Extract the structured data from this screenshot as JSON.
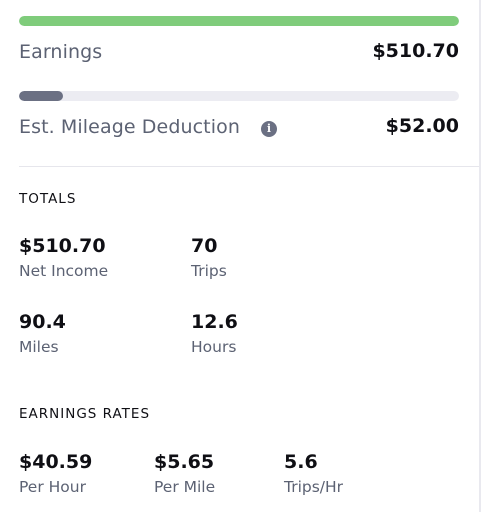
{
  "earnings": {
    "label": "Earnings",
    "value": "$510.70",
    "bar_fraction": 1.0,
    "bar_color": "#7fcc7b"
  },
  "mileage": {
    "label": "Est. Mileage Deduction",
    "value": "$52.00",
    "bar_fraction": 0.1,
    "bar_color": "#6b7083",
    "icon": "info-icon"
  },
  "totals": {
    "title": "TOTALS",
    "net_income": {
      "value": "$510.70",
      "label": "Net Income"
    },
    "trips": {
      "value": "70",
      "label": "Trips"
    },
    "miles": {
      "value": "90.4",
      "label": "Miles"
    },
    "hours": {
      "value": "12.6",
      "label": "Hours"
    }
  },
  "rates": {
    "title": "EARNINGS RATES",
    "per_hour": {
      "value": "$40.59",
      "label": "Per Hour"
    },
    "per_mile": {
      "value": "$5.65",
      "label": "Per Mile"
    },
    "trips_per_hr": {
      "value": "5.6",
      "label": "Trips/Hr"
    }
  }
}
